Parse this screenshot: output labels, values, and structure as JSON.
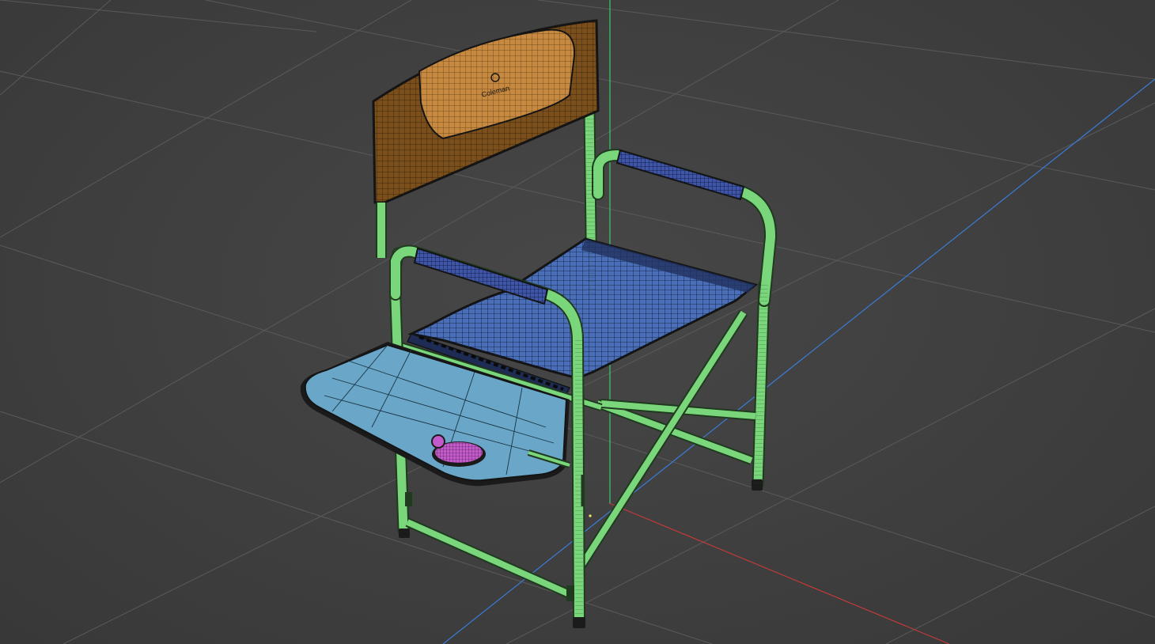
{
  "viewport": {
    "background": "#3d3d3d",
    "grid_color": "#5a5a5a",
    "axis_colors": {
      "x": "#c23a3a",
      "y": "#3ec96a",
      "z": "#3a7bd5"
    }
  },
  "model": {
    "frame_color": "#7ad67a",
    "frame_dark": "#1f3a1f",
    "seat_color": "#4a6fb8",
    "armrest_color": "#3f56a8",
    "backrest_color": "#c6893f",
    "table_color": "#6aa6c7",
    "cupholder_color": "#c35ac9",
    "wire_color": "#141414",
    "logo_text": "Coleman"
  }
}
